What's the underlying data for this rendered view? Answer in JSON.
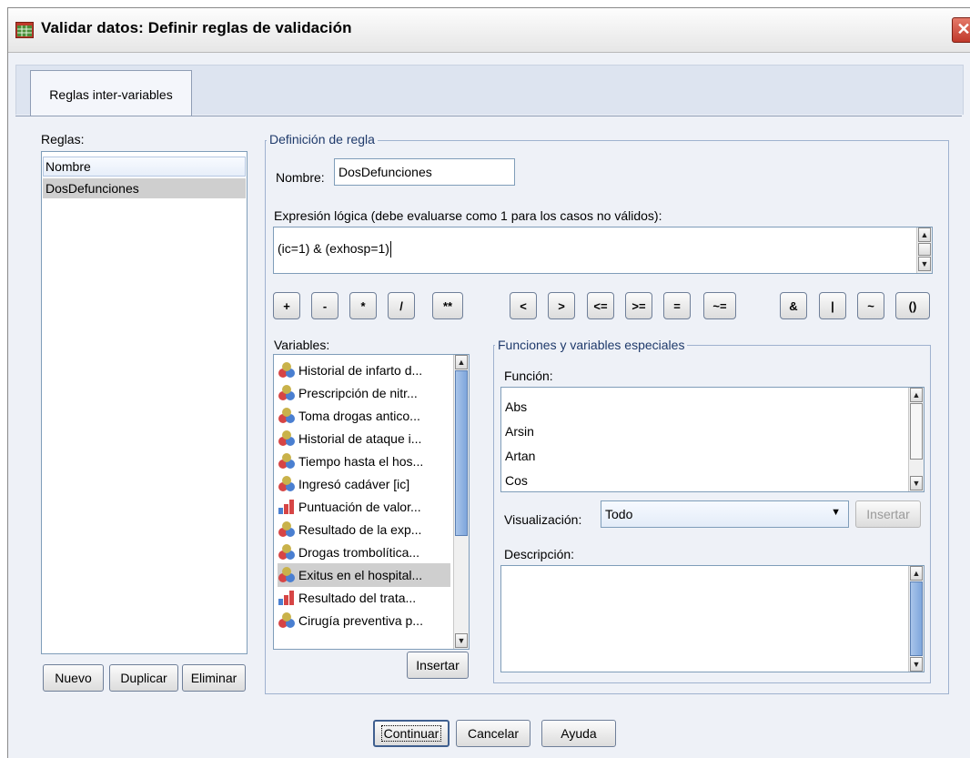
{
  "window": {
    "title": "Validar datos: Definir reglas de validación",
    "close_glyph": "✕"
  },
  "tabs": [
    {
      "label": "Reglas inter-variables"
    }
  ],
  "rules": {
    "label": "Reglas:",
    "items": [
      "Nombre",
      "DosDefunciones"
    ],
    "buttons": {
      "new": "Nuevo",
      "duplicate": "Duplicar",
      "delete": "Eliminar"
    }
  },
  "definition": {
    "group_title": "Definición de regla",
    "name_label": "Nombre:",
    "name_value": "DosDefunciones",
    "expression_label": "Expresión lógica (debe evaluarse como 1 para los casos no válidos):",
    "expression_value": "(ic=1) & (exhosp=1)"
  },
  "operators": {
    "arith": [
      "+",
      "-",
      "*",
      "/",
      "**"
    ],
    "relational": [
      "<",
      ">",
      "<=",
      ">=",
      "=",
      "~="
    ],
    "logical": [
      "&",
      "|",
      "~",
      "()"
    ]
  },
  "variables": {
    "label": "Variables:",
    "items": [
      {
        "label": "Historial de infarto d...",
        "icon": "nominal-icon"
      },
      {
        "label": "Prescripción de nitr...",
        "icon": "nominal-icon"
      },
      {
        "label": "Toma drogas antico...",
        "icon": "nominal-icon"
      },
      {
        "label": "Historial de ataque i...",
        "icon": "nominal-icon"
      },
      {
        "label": "Tiempo hasta el hos...",
        "icon": "nominal-icon"
      },
      {
        "label": "Ingresó cadáver [ic]",
        "icon": "nominal-icon"
      },
      {
        "label": "Puntuación de valor...",
        "icon": "ordinal-icon"
      },
      {
        "label": "Resultado de la exp...",
        "icon": "nominal-icon"
      },
      {
        "label": "Drogas trombolítica...",
        "icon": "nominal-icon"
      },
      {
        "label": "Exitus en el hospital...",
        "icon": "nominal-icon"
      },
      {
        "label": "Resultado del trata...",
        "icon": "ordinal-icon"
      },
      {
        "label": "Cirugía preventiva p...",
        "icon": "nominal-icon"
      }
    ],
    "selected_index": 9,
    "insert_button": "Insertar"
  },
  "functions": {
    "group_title": "Funciones y variables especiales",
    "function_label": "Función:",
    "items": [
      "Abs",
      "Arsin",
      "Artan",
      "Cos"
    ],
    "display_label": "Visualización:",
    "display_value": "Todo",
    "insert_button": "Insertar",
    "description_label": "Descripción:"
  },
  "footer": {
    "continue": "Continuar",
    "cancel": "Cancelar",
    "help": "Ayuda"
  },
  "colors": {
    "accent": "#7ea6dc",
    "window_bg": "#eef1f7",
    "close_red": "#c0392b"
  }
}
